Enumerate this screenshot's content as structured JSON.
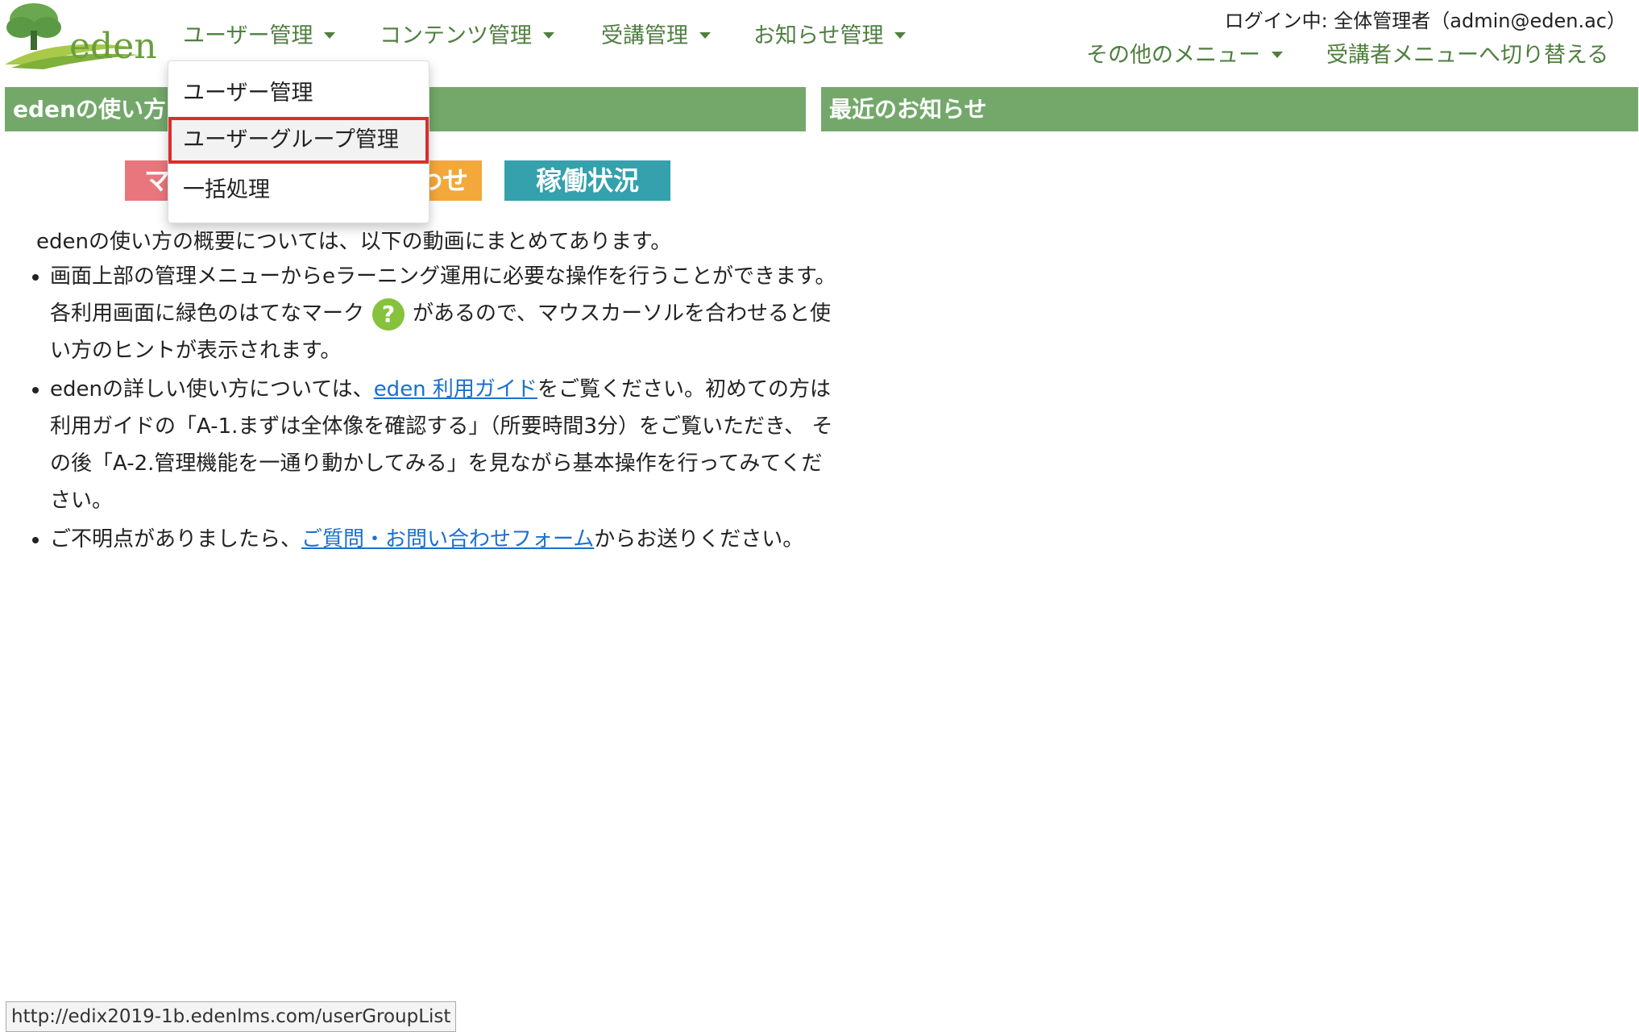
{
  "header": {
    "logo_text": "eden",
    "nav": [
      {
        "label": "ユーザー管理"
      },
      {
        "label": "コンテンツ管理"
      },
      {
        "label": "受講管理"
      },
      {
        "label": "お知らせ管理"
      }
    ],
    "login_status": "ログイン中: 全体管理者（admin@eden.ac）",
    "other_menu": "その他のメニュー",
    "switch_learner": "受講者メニューへ切り替える"
  },
  "dropdown": {
    "items": [
      "ユーザー管理",
      "ユーザーグループ管理",
      "一括処理"
    ],
    "highlighted_index": 1
  },
  "left_panel": {
    "title": "edenの使い方",
    "badges": [
      "マ",
      "わせ",
      "稼働状況"
    ],
    "intro": "edenの使い方の概要については、以下の動画にまとめてあります。",
    "bullet1_a": "画面上部の管理メニューからeラーニング運用に必要な操作を行うことができます。各利用画面に緑色のはてなマーク",
    "help_mark": "?",
    "bullet1_b": "があるので、マウスカーソルを合わせると使い方のヒントが表示されます。",
    "bullet2_a": "edenの詳しい使い方については、",
    "bullet2_link": "eden 利用ガイド",
    "bullet2_b": "をご覧ください。初めての方は利用ガイドの「A-1.まずは全体像を確認する」（所要時間3分）をご覧いただき、 その後「A-2.管理機能を一通り動かしてみる」を見ながら基本操作を行ってみてください。",
    "bullet3_a": "ご不明点がありましたら、",
    "bullet3_link": "ご質問・お問い合わせフォーム",
    "bullet3_b": "からお送りください。"
  },
  "right_panel": {
    "title": "最近のお知らせ"
  },
  "statusbar": {
    "url": "http://edix2019-1b.edenlms.com/userGroupList"
  },
  "colors": {
    "accent_green": "#73a86a",
    "nav_green": "#4e7f3f",
    "link_blue": "#1a6fd1",
    "highlight_red": "#dc2d2d"
  }
}
